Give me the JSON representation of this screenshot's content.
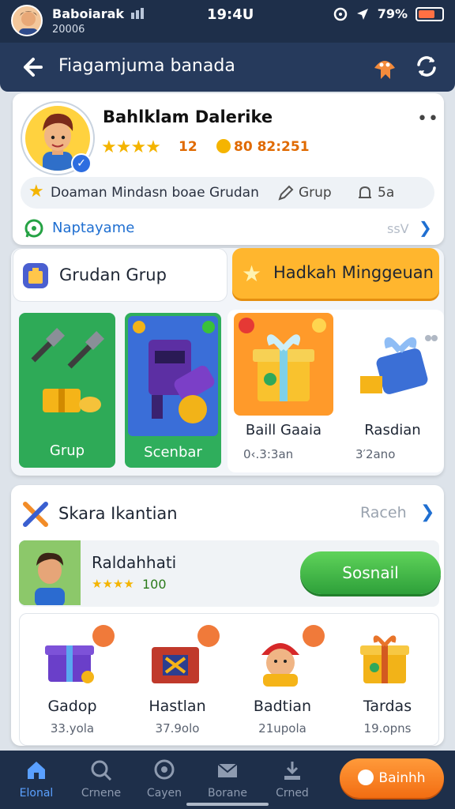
{
  "status_bar": {
    "name": "Baboiarak",
    "sub": "20006",
    "time": "19:4U",
    "battery": "79%"
  },
  "header": {
    "title": "Fiagamjuma banada"
  },
  "profile": {
    "name": "Bahlklam Dalerike",
    "stars": "★★★★",
    "rating": "12",
    "points": "80 82:251",
    "pill_text": "Doaman Mindasn boae Grudan",
    "grup_label": "Grup",
    "bell_label": "5a",
    "row_label": "Naptayame",
    "row_value": "ssV"
  },
  "groups": {
    "tab_grup": "Grudan Grup",
    "tab_weekly": "Hadkah Minggeuan",
    "tiles": [
      {
        "label": "Grup"
      },
      {
        "label": "Scenbar"
      }
    ],
    "gifts": [
      {
        "label": "Baill Gaaia",
        "sub": "0‹.3:3an"
      },
      {
        "label": "Rasdian",
        "sub": "3′2ano"
      }
    ]
  },
  "section2": {
    "title": "Skara Ikantian",
    "link": "Raceh",
    "friend": {
      "name": "Raldahhati",
      "stars": "★★★★",
      "score": "100",
      "button": "Sosnail"
    },
    "rewards": [
      {
        "label": "Gadop",
        "sub": "33.yola"
      },
      {
        "label": "Hastlan",
        "sub": "37.9olo"
      },
      {
        "label": "Badtian",
        "sub": "21upola"
      },
      {
        "label": "Tardas",
        "sub": "19.opns"
      }
    ]
  },
  "bottom_nav": {
    "items": [
      {
        "label": "Elonal",
        "icon": "home-icon"
      },
      {
        "label": "Crnene",
        "icon": "search-icon"
      },
      {
        "label": "Cayen",
        "icon": "chat-icon"
      },
      {
        "label": "Borane",
        "icon": "mail-icon"
      },
      {
        "label": "Crned",
        "icon": "download-icon"
      }
    ],
    "cta": "Bainhh"
  },
  "colors": {
    "nav_bg": "#1e2f4a",
    "header_bg": "#263a5c",
    "accent_orange": "#ffb62e",
    "accent_green": "#2ea03a",
    "link_blue": "#1f6fd1"
  }
}
